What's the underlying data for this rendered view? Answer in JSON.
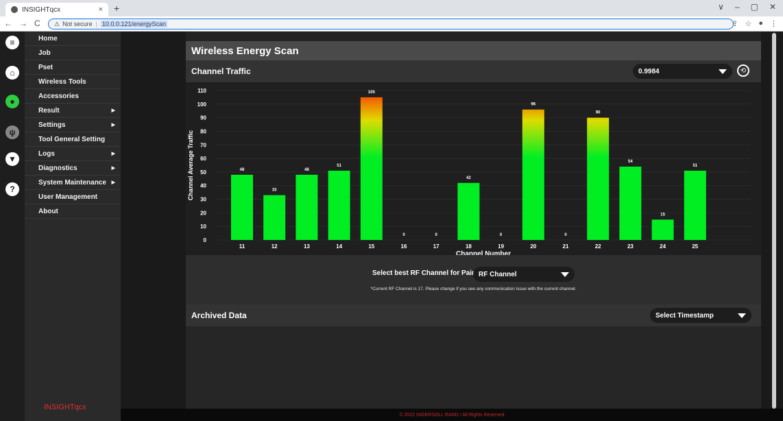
{
  "browser": {
    "tab_title": "INSIGHTqcx",
    "tab_close": "×",
    "new_tab": "+",
    "win_controls": [
      "∨",
      "–",
      "▢",
      "✕"
    ],
    "nav": [
      "←",
      "→",
      "C"
    ],
    "security": "Not secure",
    "url": "10.0.0.121/energyScan"
  },
  "menu": {
    "items": [
      {
        "label": "Home",
        "arrow": ""
      },
      {
        "label": "Job",
        "arrow": ""
      },
      {
        "label": "Pset",
        "arrow": ""
      },
      {
        "label": "Wireless Tools",
        "arrow": ""
      },
      {
        "label": "Accessories",
        "arrow": ""
      },
      {
        "label": "Result",
        "arrow": "▶"
      },
      {
        "label": "Settings",
        "arrow": "▶"
      },
      {
        "label": "Tool General Setting",
        "arrow": ""
      },
      {
        "label": "Logs",
        "arrow": "▶"
      },
      {
        "label": "Diagnostics",
        "arrow": "▶"
      },
      {
        "label": "System Maintenance",
        "arrow": "▶"
      },
      {
        "label": "User Management",
        "arrow": ""
      },
      {
        "label": "About",
        "arrow": ""
      }
    ],
    "brand": "INSIGHTqcx"
  },
  "rail": {
    "icons": [
      {
        "name": "menu-toggle-icon",
        "glyph": "≡",
        "bg": "#ffffff",
        "fg": "#1e1e1e"
      },
      {
        "name": "home-icon",
        "glyph": "⌂",
        "bg": "#ffffff",
        "fg": "#1e1e1e"
      },
      {
        "name": "user-icon",
        "glyph": "●",
        "bg": "#2ecc40",
        "fg": "#1e1e1e"
      },
      {
        "name": "usb-icon",
        "glyph": "ψ",
        "bg": "#888888",
        "fg": "#1e1e1e"
      },
      {
        "name": "download-icon",
        "glyph": "▼",
        "bg": "#ffffff",
        "fg": "#1e1e1e"
      },
      {
        "name": "help-icon",
        "glyph": "?",
        "bg": "#ffffff",
        "fg": "#1e1e1e"
      }
    ]
  },
  "page": {
    "title": "Wireless Energy Scan",
    "channel_traffic": "Channel Traffic",
    "traffic_select": "0.9984",
    "pairing_label": "Select best RF Channel for Pairing",
    "rf_select": "RF Channel",
    "note": "*Current RF Channel is 17. Please change if you see any communication issue with the current channel.",
    "archived": "Archived Data",
    "timestamp_select": "Select Timestamp"
  },
  "footer": "© 2022 INGERSOLL RAND / All Rights Reserved",
  "colors": {
    "bar_low": "#00ee22",
    "bar_mid": "#dddd00",
    "bar_high": "#ff3300"
  },
  "chart_data": {
    "type": "bar",
    "categories": [
      "11",
      "12",
      "13",
      "14",
      "15",
      "16",
      "17",
      "18",
      "19",
      "20",
      "21",
      "22",
      "23",
      "24",
      "25"
    ],
    "values": [
      48,
      33,
      48,
      51,
      105,
      0,
      0,
      42,
      0,
      96,
      0,
      90,
      54,
      15,
      51
    ],
    "xlabel": "Channel Number",
    "ylabel": "Channel Average Traffic",
    "ylim": [
      0,
      110
    ],
    "yticks": [
      0,
      10,
      20,
      30,
      40,
      50,
      60,
      70,
      80,
      90,
      100,
      110
    ],
    "grid": true
  }
}
